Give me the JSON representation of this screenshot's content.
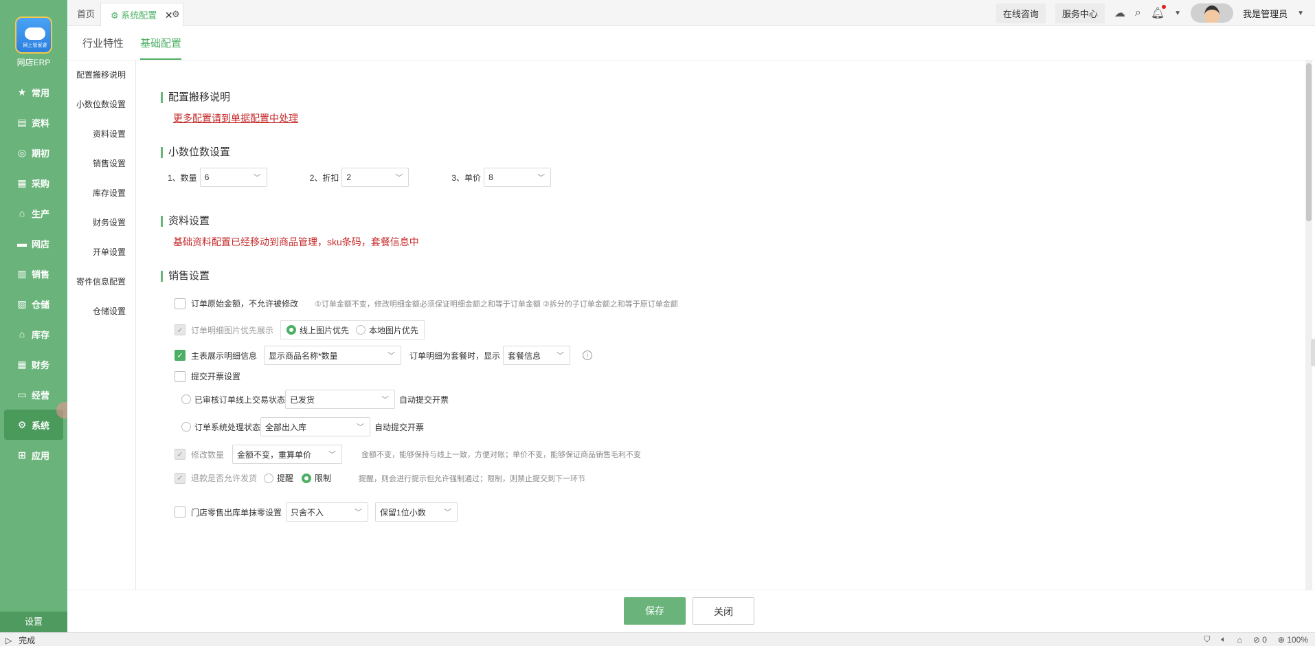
{
  "app": {
    "logo_text": "网上管家婆",
    "name": "网店ERP",
    "settings_label": "设置"
  },
  "sidebar": {
    "items": [
      {
        "label": "常用",
        "icon": "star-icon"
      },
      {
        "label": "资料",
        "icon": "document-icon"
      },
      {
        "label": "期初",
        "icon": "circle-icon"
      },
      {
        "label": "采购",
        "icon": "cart-icon"
      },
      {
        "label": "生产",
        "icon": "factory-icon"
      },
      {
        "label": "网店",
        "icon": "store-icon"
      },
      {
        "label": "销售",
        "icon": "chart-icon"
      },
      {
        "label": "仓储",
        "icon": "warehouse-icon"
      },
      {
        "label": "库存",
        "icon": "home-icon"
      },
      {
        "label": "财务",
        "icon": "finance-icon"
      },
      {
        "label": "经营",
        "icon": "briefcase-icon"
      },
      {
        "label": "系统",
        "icon": "gear-icon"
      },
      {
        "label": "应用",
        "icon": "plus-icon"
      }
    ]
  },
  "topbar": {
    "tabs": {
      "home": "首页",
      "config": "系统配置"
    },
    "online_consult": "在线咨询",
    "service_center": "服务中心",
    "user_name": "我是管理员"
  },
  "subtabs": {
    "industry": "行业特性",
    "basic": "基础配置"
  },
  "leftnav": [
    "配置搬移说明",
    "小数位数设置",
    "资料设置",
    "销售设置",
    "库存设置",
    "财务设置",
    "开单设置",
    "寄件信息配置",
    "仓储设置"
  ],
  "sections": {
    "migrate": {
      "title": "配置搬移说明",
      "link": "更多配置请到单据配置中处理"
    },
    "decimal": {
      "title": "小数位数设置",
      "qty_label": "1、数量",
      "qty_value": "6",
      "discount_label": "2、折扣",
      "discount_value": "2",
      "price_label": "3、单价",
      "price_value": "8"
    },
    "data": {
      "title": "资料设置",
      "notice": "基础资料配置已经移动到商品管理，sku条码，套餐信息中"
    },
    "sales": {
      "title": "销售设置",
      "orig_amount": "订单原始金额，不允许被修改",
      "orig_note": "①订单金额不变，修改明细金额必须保证明细金额之和等于订单金额 ②拆分的子订单金额之和等于原订单金额",
      "img_priority": "订单明细图片优先展示",
      "img_online": "线上图片优先",
      "img_local": "本地图片优先",
      "main_detail": "主表展示明细信息",
      "main_detail_value": "显示商品名称*数量",
      "combo_label": "订单明细为套餐时，显示",
      "combo_value": "套餐信息",
      "invoice": "提交开票设置",
      "inv_opt1": "已审核订单线上交易状态",
      "inv_opt1_value": "已发货",
      "inv_auto1": "自动提交开票",
      "inv_opt2": "订单系统处理状态",
      "inv_opt2_value": "全部出入库",
      "inv_auto2": "自动提交开票",
      "modify_qty": "修改数量",
      "modify_qty_value": "金额不变，重算单价",
      "modify_note": "金额不变，能够保持与线上一致，方便对账；单价不变，能够保证商品销售毛利不变",
      "refund": "退款是否允许发货",
      "refund_remind": "提醒",
      "refund_limit": "限制",
      "refund_note": "提醒，则会进行提示但允许强制通过；限制，则禁止提交到下一环节",
      "retail": "门店零售出库单抹零设置",
      "retail_value1": "只舍不入",
      "retail_value2": "保留1位小数"
    }
  },
  "footer": {
    "save": "保存",
    "close": "关闭"
  },
  "statusbar": {
    "status": "完成",
    "count": "0",
    "zoom": "100%"
  }
}
